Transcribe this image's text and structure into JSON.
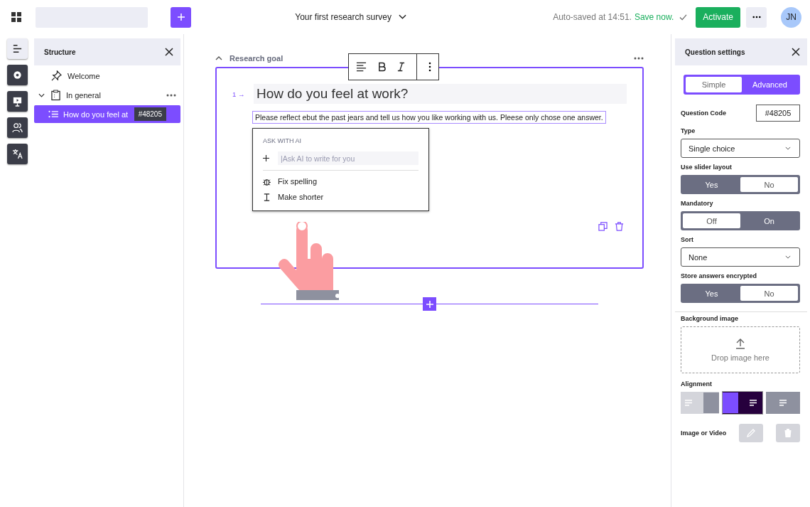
{
  "topbar": {
    "survey_title": "Your first research survey",
    "autosave": "Auto-saved at 14:51.",
    "save_link": "Save now.",
    "activate": "Activate",
    "avatar": "JN"
  },
  "rail": [
    {
      "selected": true
    },
    {
      "selected": false
    },
    {
      "selected": false
    },
    {
      "selected": false
    },
    {
      "selected": false
    }
  ],
  "structure": {
    "title": "Structure",
    "items": [
      {
        "label": "Welcome",
        "selected": false
      },
      {
        "label": "In general",
        "selected": false,
        "expanded": true,
        "children": [
          {
            "label": "How do you feel at",
            "code": "#48205",
            "selected": true
          }
        ]
      }
    ]
  },
  "editor": {
    "section": "Research goal",
    "number": "1 →",
    "question": "How do you feel at work?",
    "description": "Please reflect ebut the past jears and tell us how you like working with us. Pleese only chose one answer.",
    "ai_menu": {
      "heading": "ASK WITH AI",
      "placeholder": "|Ask AI to write for you",
      "actions": [
        {
          "label": "Fix spelling"
        },
        {
          "label": "Make shorter"
        }
      ]
    }
  },
  "settings": {
    "title": "Question settings",
    "mode": [
      {
        "label": "Simple",
        "selected": false
      },
      {
        "label": "Advanced",
        "selected": true
      }
    ],
    "fields": [
      {
        "kind": "code",
        "label": "Question Code",
        "value": "#48205"
      },
      {
        "kind": "select",
        "label": "Type",
        "value": "Single choice"
      },
      {
        "kind": "toggle",
        "label": "Use slider layout",
        "options": [
          {
            "label": "Yes",
            "selected": true
          },
          {
            "label": "No",
            "selected": false
          }
        ]
      },
      {
        "kind": "toggle",
        "label": "Mandatory",
        "options": [
          {
            "label": "Off",
            "selected": false
          },
          {
            "label": "On",
            "selected": true
          }
        ]
      },
      {
        "kind": "select",
        "label": "Sort",
        "value": "None"
      },
      {
        "kind": "toggle",
        "label": "Store answers encrypted",
        "options": [
          {
            "label": "Yes",
            "selected": true
          },
          {
            "label": "No",
            "selected": false
          }
        ]
      },
      {
        "kind": "upload",
        "label": "Background image",
        "hint": "Drop image here"
      },
      {
        "kind": "alignment",
        "label": "Alignment",
        "options": [
          {
            "selected": false
          },
          {
            "selected": true
          },
          {
            "selected": false
          }
        ]
      },
      {
        "kind": "media",
        "label": "Image or Video"
      }
    ]
  }
}
